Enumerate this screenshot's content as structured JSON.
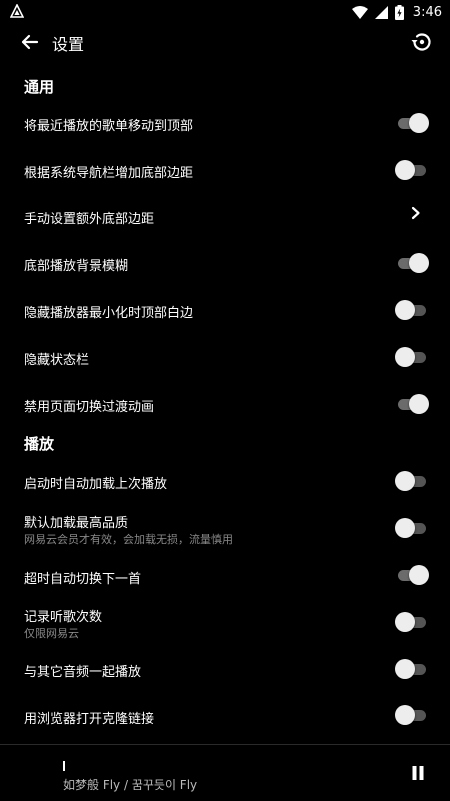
{
  "status_bar": {
    "time": "3:46",
    "icons": [
      "app-notification-icon",
      "wifi-icon",
      "signal-icon",
      "battery-charging-icon"
    ]
  },
  "app_bar": {
    "title": "设置",
    "back_icon": "back-arrow-icon",
    "action_icon": "restore-icon"
  },
  "sections": {
    "general": {
      "title": "通用",
      "items": [
        {
          "label": "将最近播放的歌单移动到顶部",
          "type": "toggle",
          "on": true
        },
        {
          "label": "根据系统导航栏增加底部边距",
          "type": "toggle",
          "on": false
        },
        {
          "label": "手动设置额外底部边距",
          "type": "link"
        },
        {
          "label": "底部播放背景模糊",
          "type": "toggle",
          "on": true
        },
        {
          "label": "隐藏播放器最小化时顶部白边",
          "type": "toggle",
          "on": false
        },
        {
          "label": "隐藏状态栏",
          "type": "toggle",
          "on": false
        },
        {
          "label": "禁用页面切换过渡动画",
          "type": "toggle",
          "on": true
        }
      ]
    },
    "playback": {
      "title": "播放",
      "items": [
        {
          "label": "启动时自动加载上次播放",
          "type": "toggle",
          "on": false
        },
        {
          "label": "默认加载最高品质",
          "subtitle": "网易云会员才有效，会加载无损，流量慎用",
          "type": "toggle",
          "on": false
        },
        {
          "label": "超时自动切换下一首",
          "type": "toggle",
          "on": true
        },
        {
          "label": "记录听歌次数",
          "subtitle": "仅限网易云",
          "type": "toggle",
          "on": false
        },
        {
          "label": "与其它音频一起播放",
          "type": "toggle",
          "on": false
        },
        {
          "label": "用浏览器打开克隆链接",
          "type": "toggle",
          "on": false
        }
      ]
    }
  },
  "player": {
    "song": "如梦般 Fly / 꿈꾸듯이 Fly",
    "state": "playing",
    "control_icon": "pause-icon"
  }
}
